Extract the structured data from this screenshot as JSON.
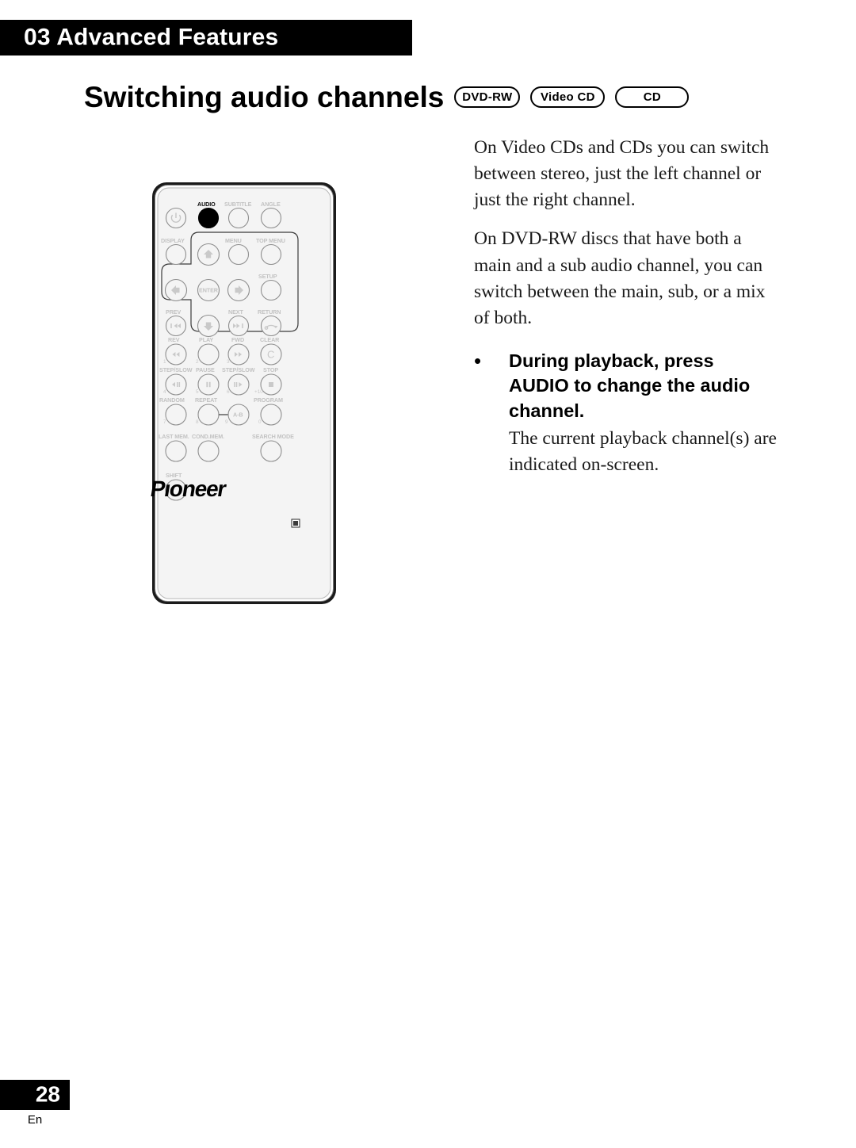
{
  "page": {
    "chapter_label": "03 Advanced Features",
    "section_title": "Switching audio channels",
    "page_number": "28",
    "language_code": "En"
  },
  "disc_badges": [
    {
      "label": "DVD-RW",
      "name": "badge-dvd-rw"
    },
    {
      "label": "Video CD",
      "name": "badge-video-cd"
    },
    {
      "label": "CD",
      "name": "badge-cd"
    }
  ],
  "body": {
    "paragraph_1": "On Video CDs and CDs you can switch between stereo, just the left channel or just the right channel.",
    "paragraph_2": "On DVD-RW discs that have both a main and a sub audio channel, you can switch between the main, sub, or a mix of both.",
    "bullet": {
      "marker": "•",
      "heading": "During playback, press AUDIO to change the audio channel.",
      "detail": "The current playback channel(s) are indicated on-screen."
    }
  },
  "remote": {
    "brand": "Pioneer",
    "highlighted_button": "AUDIO",
    "labels": {
      "audio": "AUDIO",
      "subtitle": "SUBTITLE",
      "angle": "ANGLE",
      "display": "DISPLAY",
      "menu": "MENU",
      "top_menu": "TOP MENU",
      "setup": "SETUP",
      "enter": "ENTER",
      "prev": "PREV",
      "next": "NEXT",
      "return": "RETURN",
      "rev": "REV",
      "play": "PLAY",
      "fwd": "FWD",
      "clear": "CLEAR",
      "step_slow_left": "STEP/SLOW",
      "pause": "PAUSE",
      "step_slow_right": "STEP/SLOW",
      "stop": "STOP",
      "random": "RANDOM",
      "repeat": "REPEAT",
      "ab": "A-B",
      "program": "PROGRAM",
      "last_mem": "LAST MEM.",
      "cond_mem": "COND.MEM.",
      "search_mode": "SEARCH MODE",
      "shift": "SHIFT",
      "clear_glyph": "C"
    },
    "numbers": {
      "n1": "1",
      "n2": "2",
      "n3": "3",
      "n4": "4",
      "n5": "5",
      "n6": "6",
      "plus10": "+10",
      "n7": "7",
      "n8": "8",
      "n9": "9",
      "n0": "0"
    },
    "colors": {
      "body_fill": "#f2f2f2",
      "shell_outline": "#000000",
      "label_gray": "#c2c2c2",
      "button_stroke": "#8e8e8e",
      "highlight_fill": "#000000",
      "accent_black": "#000000"
    }
  }
}
